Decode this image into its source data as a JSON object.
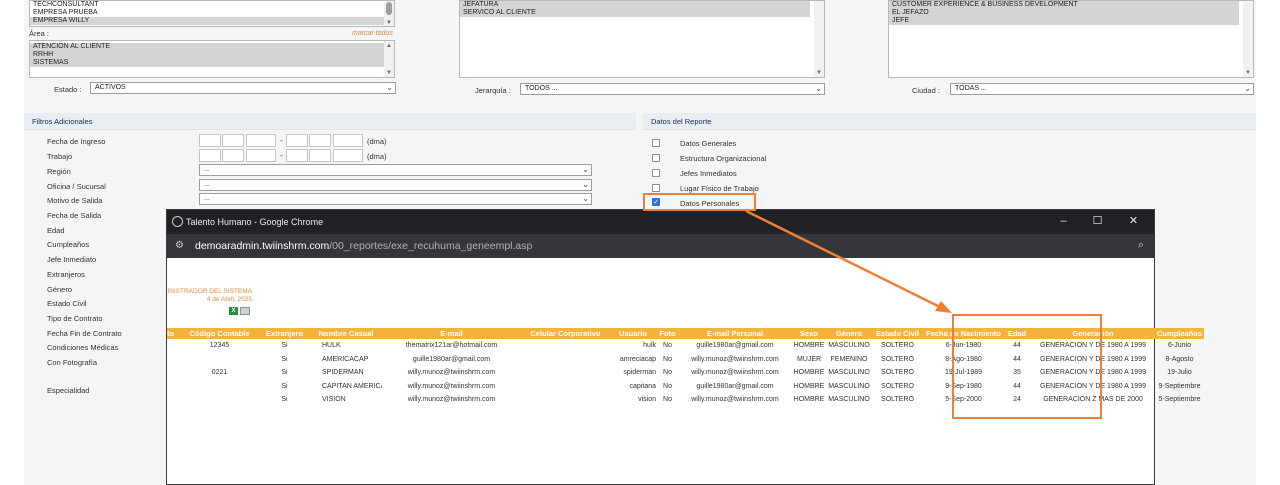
{
  "background": {
    "empresa_list": [
      "TECHCONSULTANT",
      "EMPRESA PRUEBA",
      "EMPRESA WILLY"
    ],
    "area_label": "Área :",
    "marcar_todos": "marcar todos",
    "area_list": [
      "ATENCIÓN AL CLIENTE",
      "RRHH",
      "SISTEMAS"
    ],
    "estado_label": "Estado :",
    "estado_value": "ACTIVOS",
    "mid_list": [
      "JEFATURA",
      "SERVICO AL CLIENTE"
    ],
    "jerarquia_label": "Jerarquía :",
    "jerarquia_value": "TODOS ...",
    "right_list": [
      "CUSTOMER EXPERIENCE & BUSINESS DEVELOPMENT",
      "EL JEFAZO",
      "JEFE"
    ],
    "ciudad_label": "Ciudad :",
    "ciudad_value": "TODAS ...",
    "filtros_title": "Filtros Adicionales",
    "filtros": [
      "Fecha de Ingreso",
      "Trabajo",
      "Región",
      "Oficina / Sucursal",
      "Motivo de Salida",
      "Fecha de Salida",
      "Edad",
      "Cumpleaños",
      "Jefe Inmediato",
      "Extranjeros",
      "Género",
      "Estado Civil",
      "Tipo de Contrato",
      "Fecha Fin de Contrato",
      "Condiciones Médicas",
      "Con Fotografía",
      "Especialidad"
    ],
    "dma": "(dma)",
    "select_placeholder": "...",
    "datos_title": "Datos del Reporte",
    "datos": [
      "Datos Generales",
      "Estructura Organizacional",
      "Jefes Inmediatos",
      "Lugar Físico de Trabajo",
      "Datos Personales"
    ]
  },
  "popup": {
    "title": "Talento Humano - Google Chrome",
    "url_domain": "demoaradmin.twiinshrm.com",
    "url_path": "/00_reportes/exe_recuhuma_geneempl.asp",
    "admin_line": "INISTRADOR DEL SISTEMA",
    "date_line": "4 de Abril, 2025",
    "xls_icon": "X"
  },
  "table": {
    "headers": [
      "to",
      "Código Contable",
      "Extranjero",
      "Nombre Casual",
      "E-mail",
      "Celular Corporativo",
      "Usuario",
      "Foto",
      "E-mail Personal",
      "Sexo",
      "Género",
      "Estado Civil",
      "Fecha de Nacimiento",
      "Edad",
      "Generación",
      "Cumpleaños"
    ],
    "rows": [
      [
        "",
        "12345",
        "Si",
        "HULK",
        "thematrix121ar@hotmail.com",
        "",
        "hulk",
        "No",
        "guille1980ar@gmail.com",
        "HOMBRE",
        "MASCULINO",
        "SOLTERO",
        "6-Jun-1980",
        "44",
        "GENERACION Y DE 1980 A 1999",
        "6-Junio"
      ],
      [
        "",
        "",
        "Si",
        "AMERICACAP",
        "guille1980ar@gmail.com",
        "",
        "amreciacap",
        "No",
        "willy.munoz@twiinshrm.com",
        "MUJER",
        "FEMENINO",
        "SOLTERO",
        "8-Ago-1980",
        "44",
        "GENERACION Y DE 1980 A 1999",
        "8-Agosto"
      ],
      [
        "",
        "0221",
        "Si",
        "SPIDERMAN",
        "willy.munoz@twiinshrm.com",
        "",
        "spiderman",
        "No",
        "willy.munoz@twiinshrm.com",
        "HOMBRE",
        "MASCULINO",
        "SOLTERO",
        "19-Jul-1989",
        "35",
        "GENERACION Y DE 1980 A 1999",
        "19-Julio"
      ],
      [
        "",
        "",
        "Si",
        "CAPITAN AMERICA",
        "willy.munoz@twiinshrm.com",
        "",
        "capitana",
        "No",
        "guille1980ar@gmail.com",
        "HOMBRE",
        "MASCULINO",
        "SOLTERO",
        "9-Sep-1980",
        "44",
        "GENERACION Y DE 1980 A 1999",
        "9-Septiembre"
      ],
      [
        "",
        "",
        "Si",
        "VISION",
        "willy.munoz@twiinshrm.com",
        "",
        "vision",
        "No",
        "willy.munoz@twiinshrm.com",
        "HOMBRE",
        "MASCULINO",
        "SOLTERO",
        "5-Sep-2000",
        "24",
        "GENERACION Z MAS DE 2000",
        "5-Septiembre"
      ]
    ]
  },
  "colors": {
    "header_orange": "#f3b23a",
    "annotation_orange": "#ef7f35",
    "checkbox_blue": "#2f6fd6"
  }
}
